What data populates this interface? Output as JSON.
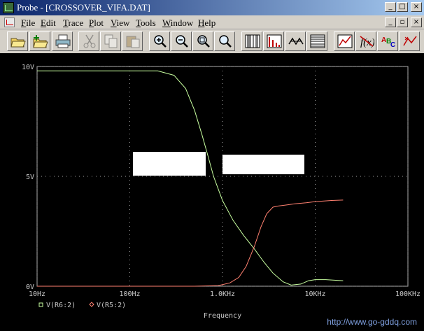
{
  "window": {
    "title": "Probe - [CROSSOVER_VIFA.DAT]",
    "minimize": "_",
    "maximize": "□",
    "close": "×"
  },
  "menu": {
    "items": [
      "File",
      "Edit",
      "Trace",
      "Plot",
      "View",
      "Tools",
      "Window",
      "Help"
    ]
  },
  "toolbar": {
    "buttons": [
      {
        "name": "open-file-icon",
        "enabled": true
      },
      {
        "name": "append-file-icon",
        "enabled": true
      },
      {
        "name": "print-icon",
        "enabled": true
      },
      {
        "name": "cut-icon",
        "enabled": false
      },
      {
        "name": "copy-icon",
        "enabled": false
      },
      {
        "name": "paste-icon",
        "enabled": false
      },
      {
        "name": "zoom-in-icon",
        "enabled": true
      },
      {
        "name": "zoom-out-icon",
        "enabled": true
      },
      {
        "name": "zoom-area-icon",
        "enabled": true
      },
      {
        "name": "zoom-fit-icon",
        "enabled": true
      },
      {
        "name": "log-x-axis-icon",
        "enabled": true
      },
      {
        "name": "fourier-icon",
        "enabled": true
      },
      {
        "name": "performance-analysis-icon",
        "enabled": true
      },
      {
        "name": "log-y-axis-icon",
        "enabled": true
      },
      {
        "name": "add-trace-icon",
        "enabled": true
      },
      {
        "name": "eval-goal-function-icon",
        "enabled": true
      },
      {
        "name": "text-label-icon",
        "enabled": true
      },
      {
        "name": "mark-data-points-icon",
        "enabled": true
      }
    ]
  },
  "chart_data": {
    "type": "line",
    "xscale": "log",
    "xlim": [
      10,
      100000
    ],
    "ylim": [
      0,
      10
    ],
    "xticks": [
      "10Hz",
      "100Hz",
      "1.0KHz",
      "10KHz",
      "100KHz"
    ],
    "xtick_values": [
      10,
      100,
      1000,
      10000,
      100000
    ],
    "yticks": [
      "0V",
      "5V",
      "10V"
    ],
    "ytick_values": [
      0,
      5,
      10
    ],
    "xlabel": "Frequency",
    "grid": true,
    "legend_position": "bottom-left",
    "series": [
      {
        "name": "V(R6:2)",
        "color": "#c8ffa0",
        "marker": "square",
        "x": [
          10,
          60,
          200,
          300,
          400,
          500,
          600,
          700,
          800,
          1000,
          1300,
          1700,
          2200,
          2800,
          3500,
          4500,
          5500,
          7000,
          8500,
          10000,
          13000,
          20000
        ],
        "y": [
          9.8,
          9.8,
          9.8,
          9.6,
          9.0,
          8.0,
          6.9,
          5.9,
          5.0,
          3.9,
          3.0,
          2.3,
          1.7,
          1.1,
          0.6,
          0.2,
          0.05,
          0.1,
          0.25,
          0.3,
          0.3,
          0.25
        ]
      },
      {
        "name": "V(R5:2)",
        "color": "#ff8070",
        "marker": "diamond",
        "x": [
          10,
          500,
          900,
          1200,
          1500,
          1800,
          2200,
          2600,
          3000,
          3500,
          4000,
          5000,
          6000,
          8000,
          10000,
          15000,
          20000
        ],
        "y": [
          0,
          0,
          0.03,
          0.15,
          0.4,
          0.9,
          1.8,
          2.7,
          3.3,
          3.6,
          3.65,
          3.7,
          3.75,
          3.8,
          3.85,
          3.9,
          3.92
        ]
      }
    ]
  },
  "watermark": {
    "text": "http://www.go-gddq.com"
  }
}
